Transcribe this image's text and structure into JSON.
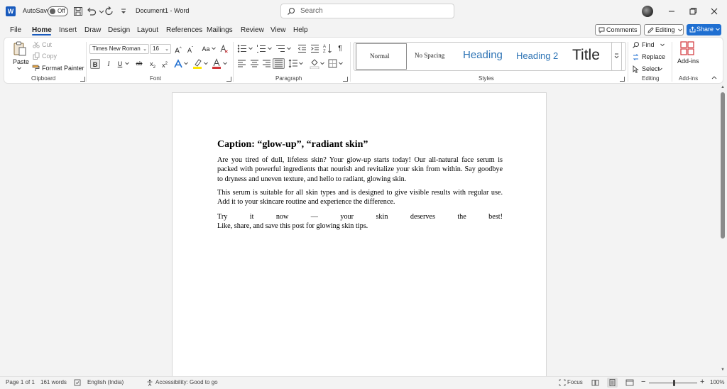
{
  "titlebar": {
    "app_icon": "W",
    "autosave_label": "AutoSave",
    "autosave_state": "Off",
    "doc_title": "Document1  -  Word",
    "search_placeholder": "Search",
    "icons": [
      "save-icon",
      "undo-icon",
      "redo-icon",
      "customize-qat-icon",
      "minimize-icon",
      "restore-icon",
      "close-icon"
    ]
  },
  "tabs": [
    "File",
    "Home",
    "Insert",
    "Draw",
    "Design",
    "Layout",
    "References",
    "Mailings",
    "Review",
    "View",
    "Help"
  ],
  "active_tab": "Home",
  "actions": {
    "comments": "Comments",
    "editing": "Editing",
    "share": "Share"
  },
  "ribbon": {
    "clipboard": {
      "paste": "Paste",
      "cut": "Cut",
      "copy": "Copy",
      "format_painter": "Format Painter",
      "label": "Clipboard"
    },
    "font": {
      "font_name": "Times New Roman",
      "font_size": "16",
      "grow": "A",
      "shrink": "A",
      "change_case": "Aa",
      "bold": "B",
      "italic": "I",
      "underline": "U",
      "strikethrough": "ab",
      "subscript": "x",
      "superscript": "x",
      "label": "Font"
    },
    "paragraph": {
      "label": "Paragraph",
      "show_marks": "¶"
    },
    "styles": {
      "items": [
        "Normal",
        "No Spacing",
        "Heading",
        "Heading 2",
        "Title"
      ],
      "label": "Styles"
    },
    "editing": {
      "find": "Find",
      "replace": "Replace",
      "select": "Select",
      "label": "Editing"
    },
    "addins": {
      "button": "Add-ins",
      "label": "Add-ins"
    }
  },
  "document": {
    "heading": "Caption: “glow-up”, “radiant skin”",
    "paragraphs": [
      "Are you tired of dull, lifeless skin? Your glow-up starts today! Our all-natural face serum is packed with powerful ingredients that nourish and revitalize your skin from within. Say goodbye to dryness and uneven texture, and hello to radiant, glowing skin.",
      "This serum is suitable for all skin types and is designed to give visible results with regular use. Add it to your skincare routine and experience the difference.",
      "Try it now — your skin deserves the best!"
    ],
    "last_line": "Like, share, and save this post for glowing skin tips."
  },
  "status": {
    "page": "Page 1 of 1",
    "words": "161 words",
    "language": "English (India)",
    "accessibility": "Accessibility: Good to go",
    "focus": "Focus",
    "zoom_minus": "−",
    "zoom_plus": "+",
    "zoom": "100%",
    "zoom_level": 1.0
  },
  "colors": {
    "accent": "#185abd",
    "share_bg": "#1f6fd1",
    "heading_blue": "#2e74b5"
  }
}
